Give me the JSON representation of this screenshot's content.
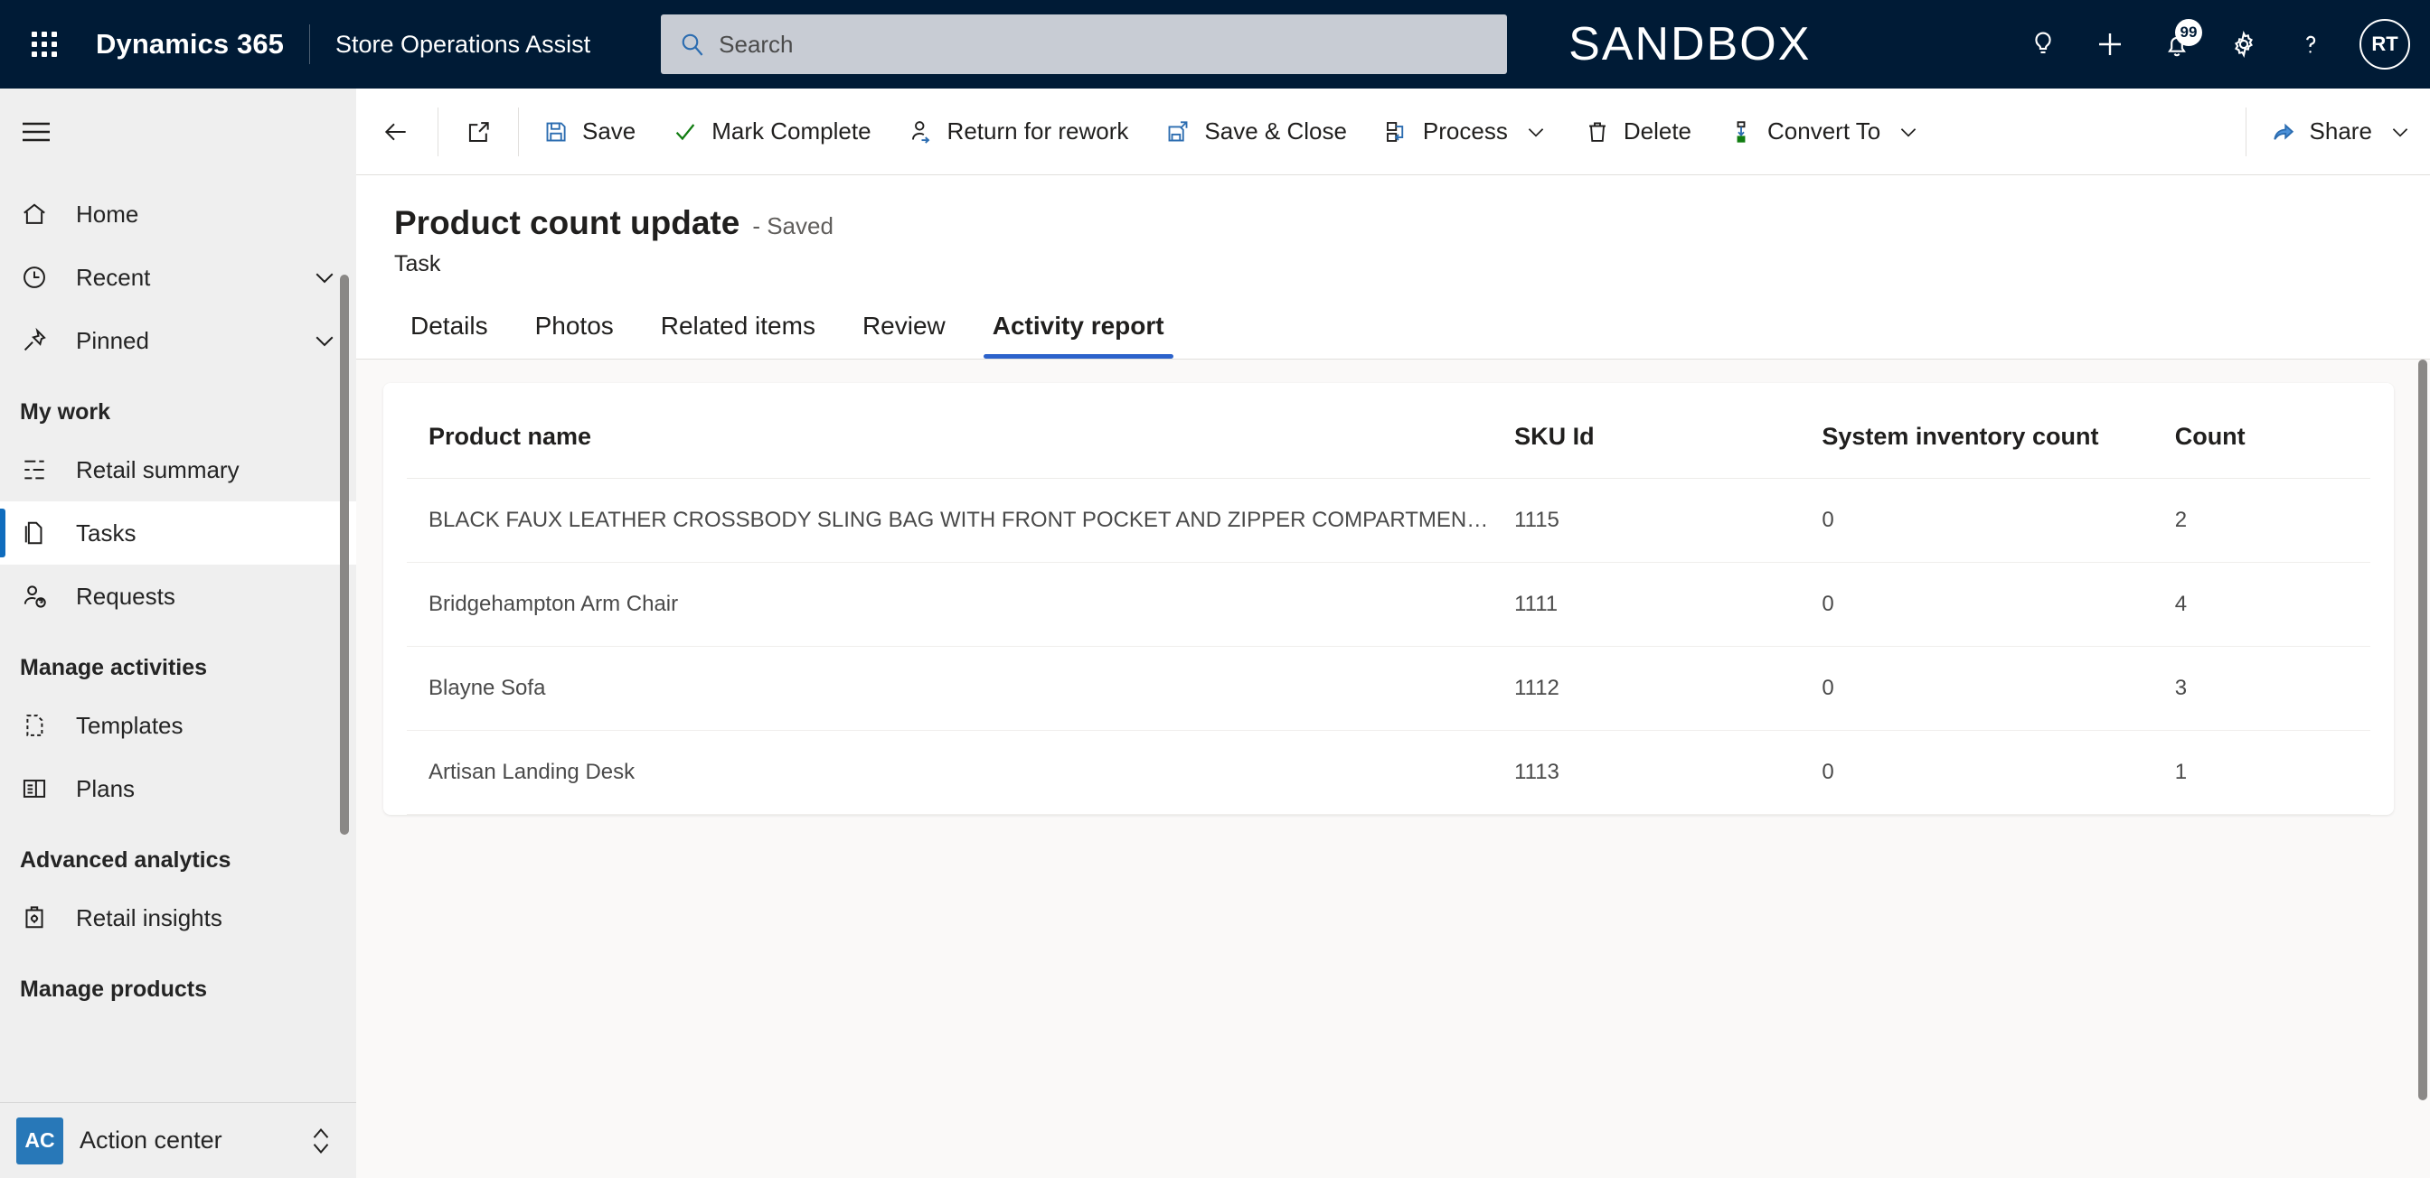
{
  "header": {
    "waffle_icon": "app-launcher-icon",
    "brand": "Dynamics 365",
    "app_name": "Store Operations Assist",
    "search": {
      "placeholder": "Search",
      "value": "",
      "icon": "search-icon"
    },
    "environment_label": "SANDBOX",
    "actions": [
      {
        "name": "lightbulb-icon",
        "label": "Insights"
      },
      {
        "name": "plus-icon",
        "label": "Quick create"
      },
      {
        "name": "bell-icon",
        "label": "Notifications",
        "badge": "99"
      },
      {
        "name": "gear-icon",
        "label": "Settings"
      },
      {
        "name": "question-icon",
        "label": "Help"
      }
    ],
    "avatar_initials": "RT"
  },
  "command_bar": {
    "back_icon": "back-arrow-icon",
    "popout_icon": "open-in-new-window-icon",
    "buttons": [
      {
        "label": "Save",
        "icon": "save-icon",
        "caret": false
      },
      {
        "label": "Mark Complete",
        "icon": "checkmark-icon",
        "caret": false
      },
      {
        "label": "Return for rework",
        "icon": "person-arrow-icon",
        "caret": false
      },
      {
        "label": "Save & Close",
        "icon": "save-close-icon",
        "caret": false
      },
      {
        "label": "Process",
        "icon": "process-icon",
        "caret": true
      },
      {
        "label": "Delete",
        "icon": "trash-icon",
        "caret": false
      },
      {
        "label": "Convert To",
        "icon": "convert-icon",
        "caret": true
      }
    ],
    "share": {
      "label": "Share",
      "icon": "share-icon",
      "caret": true
    }
  },
  "sidebar": {
    "hamburger_icon": "hamburger-menu-icon",
    "top_items": [
      {
        "label": "Home",
        "icon": "home-icon",
        "chevron": false,
        "selected": false
      },
      {
        "label": "Recent",
        "icon": "clock-icon",
        "chevron": true,
        "selected": false
      },
      {
        "label": "Pinned",
        "icon": "pin-icon",
        "chevron": true,
        "selected": false
      }
    ],
    "groups": [
      {
        "title": "My work",
        "items": [
          {
            "label": "Retail summary",
            "icon": "analytics-icon",
            "selected": false
          },
          {
            "label": "Tasks",
            "icon": "tasks-page-icon",
            "selected": true
          },
          {
            "label": "Requests",
            "icon": "person-question-icon",
            "selected": false
          }
        ]
      },
      {
        "title": "Manage activities",
        "items": [
          {
            "label": "Templates",
            "icon": "template-page-icon",
            "selected": false
          },
          {
            "label": "Plans",
            "icon": "plans-grid-icon",
            "selected": false
          }
        ]
      },
      {
        "title": "Advanced analytics",
        "items": [
          {
            "label": "Retail insights",
            "icon": "clipboard-gear-icon",
            "selected": false
          }
        ]
      },
      {
        "title": "Manage products",
        "items": []
      }
    ],
    "action_center": {
      "badge": "AC",
      "label": "Action center",
      "chevron_icon": "chevron-up-down-icon"
    }
  },
  "record": {
    "title": "Product count update",
    "status": "- Saved",
    "subtitle": "Task"
  },
  "tabs": [
    {
      "label": "Details",
      "active": false
    },
    {
      "label": "Photos",
      "active": false
    },
    {
      "label": "Related items",
      "active": false
    },
    {
      "label": "Review",
      "active": false
    },
    {
      "label": "Activity report",
      "active": true
    }
  ],
  "activity_report": {
    "columns": [
      "Product name",
      "SKU Id",
      "System inventory count",
      "Count"
    ],
    "rows": [
      {
        "product_name": "BLACK FAUX LEATHER CROSSBODY SLING BAG WITH FRONT POCKET AND ZIPPER COMPARTMENTS",
        "sku_id": "1115",
        "system_inventory_count": "0",
        "count": "2"
      },
      {
        "product_name": "Bridgehampton Arm Chair",
        "sku_id": "1111",
        "system_inventory_count": "0",
        "count": "4"
      },
      {
        "product_name": "Blayne Sofa",
        "sku_id": "1112",
        "system_inventory_count": "0",
        "count": "3"
      },
      {
        "product_name": "Artisan Landing Desk",
        "sku_id": "1113",
        "system_inventory_count": "0",
        "count": "1"
      }
    ]
  },
  "colors": {
    "header_bg": "#001b36",
    "accent_blue": "#0f6cbd",
    "tab_underline": "#2c62cb",
    "sidebar_bg": "#efefef",
    "canvas_bg": "#faf9f8",
    "action_center_badge": "#2878b8"
  }
}
